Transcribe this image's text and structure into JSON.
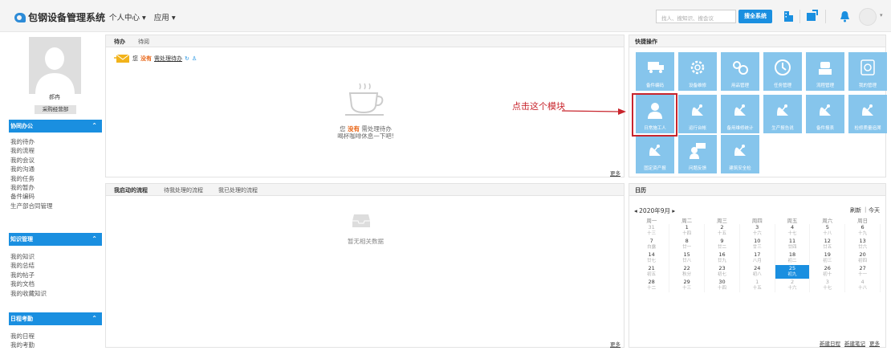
{
  "header": {
    "title": "包钢设备管理系统",
    "nav": [
      "个人中心 ▾",
      "应用 ▾"
    ],
    "search_placeholder": "找人、搜知识、搜会议",
    "search_button": "搜全系统"
  },
  "sidebar": {
    "user_name": "郝冉",
    "department": "采购经营部",
    "sections": [
      {
        "title": "协同办公",
        "items": [
          "我的待办",
          "我的流程",
          "我的会议",
          "我的沟通",
          "我的任务",
          "我的暂办",
          "备件编码",
          "生产部合同管理"
        ]
      },
      {
        "title": "知识管理",
        "items": [
          "我的知识",
          "我的总结",
          "我的帖子",
          "我的文档",
          "我的收藏知识"
        ]
      },
      {
        "title": "日程考勤",
        "items": [
          "我的日程",
          "我的考勤"
        ]
      }
    ]
  },
  "todo_panel": {
    "tabs": [
      "待办",
      "待阅"
    ],
    "status_prefix": "您",
    "status_none": "没有",
    "status_link": "需处理待办",
    "empty_prefix": "您",
    "empty_none": "没有",
    "empty_text": "需处理待办",
    "empty_sub": "喝杯咖啡休息一下吧!",
    "more": "更多"
  },
  "flow_panel": {
    "tabs": [
      "我启动的流程",
      "待我处理的流程",
      "我已处理的流程"
    ],
    "empty_text": "暂无相关数据",
    "more": "更多"
  },
  "quick_panel": {
    "title": "快捷操作",
    "annotation": "点击这个模块",
    "tiles": [
      "备件编码",
      "设备维修",
      "用品管理",
      "任务管理",
      "流程管理",
      "我的管理",
      "日常施工人",
      "运行台帐",
      "备用维修统计",
      "生产报告说",
      "备件报表",
      "检修质量追溯",
      "固定资产报",
      "问题反馈",
      "建筑安全检"
    ]
  },
  "calendar_panel": {
    "title": "日历",
    "month_label": "◂ 2020年9月 ▸",
    "refresh": "刷新",
    "today": "今天",
    "weekdays": [
      "周一",
      "周二",
      "周三",
      "周四",
      "周五",
      "周六",
      "周日"
    ],
    "weeks": [
      [
        [
          "31",
          "十三"
        ],
        [
          "1",
          "十四"
        ],
        [
          "2",
          "十五"
        ],
        [
          "3",
          "十六"
        ],
        [
          "4",
          "十七"
        ],
        [
          "5",
          "十八"
        ],
        [
          "6",
          "十九"
        ]
      ],
      [
        [
          "7",
          "白露"
        ],
        [
          "8",
          "廿一"
        ],
        [
          "9",
          "廿二"
        ],
        [
          "10",
          "廿三"
        ],
        [
          "11",
          "廿四"
        ],
        [
          "12",
          "廿五"
        ],
        [
          "13",
          "廿六"
        ]
      ],
      [
        [
          "14",
          "廿七"
        ],
        [
          "15",
          "廿八"
        ],
        [
          "16",
          "廿九"
        ],
        [
          "17",
          "八月"
        ],
        [
          "18",
          "初二"
        ],
        [
          "19",
          "初三"
        ],
        [
          "20",
          "初四"
        ]
      ],
      [
        [
          "21",
          "初五"
        ],
        [
          "22",
          "秋分"
        ],
        [
          "23",
          "初七"
        ],
        [
          "24",
          "初八"
        ],
        [
          "25",
          "初九"
        ],
        [
          "26",
          "初十"
        ],
        [
          "27",
          "十一"
        ]
      ],
      [
        [
          "28",
          "十二"
        ],
        [
          "29",
          "十三"
        ],
        [
          "30",
          "十四"
        ],
        [
          "1",
          "十五"
        ],
        [
          "2",
          "十六"
        ],
        [
          "3",
          "十七"
        ],
        [
          "4",
          "十八"
        ]
      ]
    ],
    "links": [
      "新建日程",
      "新建笔记",
      "更多"
    ]
  },
  "colors": {
    "accent": "#1a8fe0",
    "tile": "#86c5ec",
    "annotation": "#c8252d"
  }
}
